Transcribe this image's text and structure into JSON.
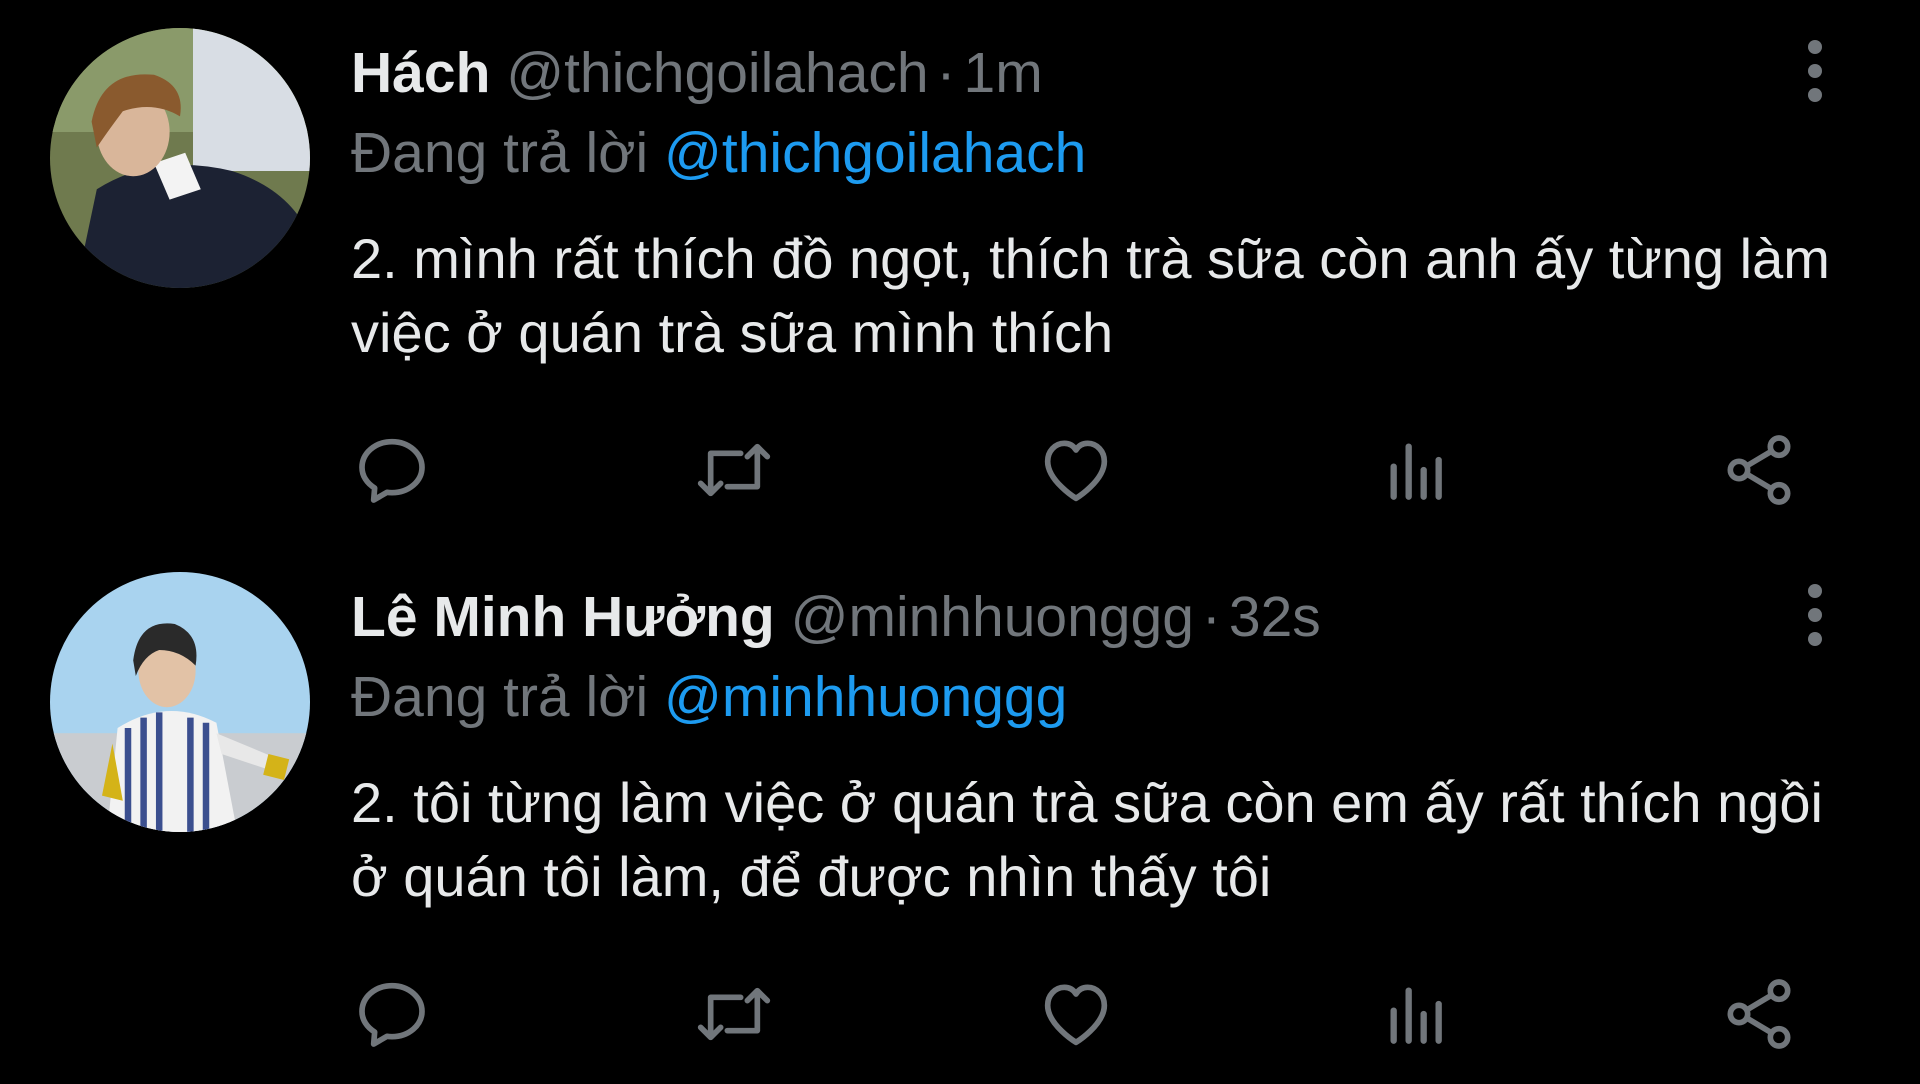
{
  "colors": {
    "background": "#000000",
    "text_primary": "#e7e9ea",
    "text_secondary": "#71767b",
    "accent_link": "#1d9bf0"
  },
  "tweets": [
    {
      "avatar_icon": "profile-photo-person-dark-sweater",
      "display_name": "Hách",
      "handle": "@thichgoilahach",
      "separator": "·",
      "time": "1m",
      "replying_label": "Đang trả lời",
      "replying_to": "@thichgoilahach",
      "text": "2. mình rất thích đồ ngọt, thích trà sữa còn anh ấy từng làm việc ở quán trà sữa mình thích",
      "actions": [
        "reply-icon",
        "retweet-icon",
        "like-icon",
        "views-icon",
        "share-icon"
      ]
    },
    {
      "avatar_icon": "profile-photo-person-striped-shirt",
      "display_name": "Lê Minh Hưởng",
      "handle": "@minhhuonggg",
      "separator": "·",
      "time": "32s",
      "replying_label": "Đang trả lời",
      "replying_to": "@minhhuonggg",
      "text": "2. tôi từng làm việc ở quán trà sữa còn em ấy rất thích ngồi ở quán tôi làm, để được nhìn thấy tôi",
      "actions": [
        "reply-icon",
        "retweet-icon",
        "like-icon",
        "views-icon",
        "share-icon"
      ]
    }
  ]
}
